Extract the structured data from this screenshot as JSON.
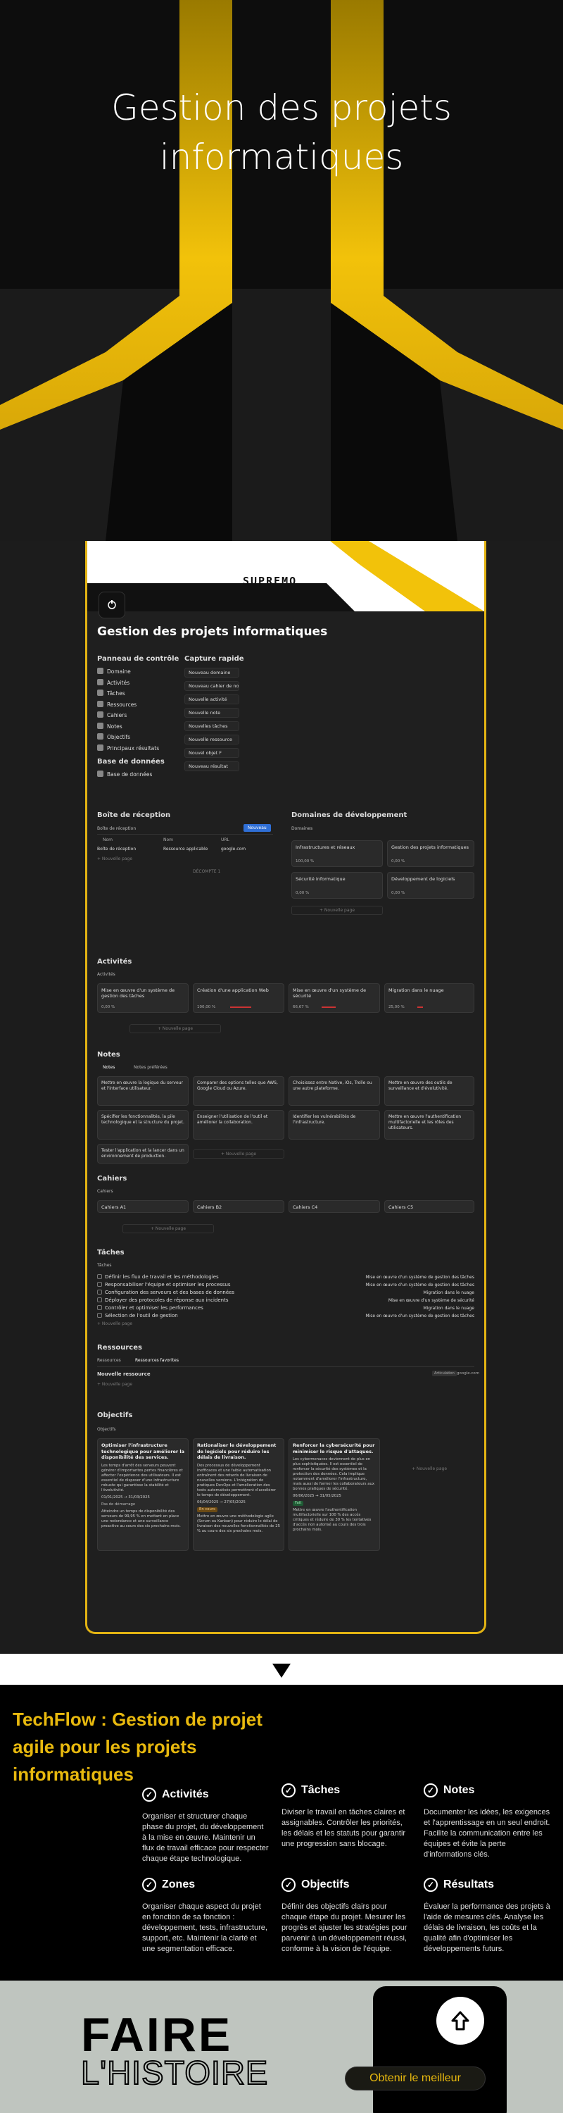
{
  "hero": {
    "title_line1": "Gestion des projets",
    "title_line2": "informatiques"
  },
  "app": {
    "logo": "SUPREMO",
    "page_title": "Gestion des projets informatiques",
    "panel": {
      "heading": "Panneau de contrôle",
      "items": [
        "Domaine",
        "Activités",
        "Tâches",
        "Ressources",
        "Cahiers",
        "Notes",
        "Objectifs",
        "Principaux résultats"
      ],
      "db_heading": "Base de données",
      "db_item": "Base de données"
    },
    "quick": {
      "heading": "Capture rapide",
      "items": [
        "Nouveau domaine",
        "Nouveau cahier de notes",
        "Nouvelle activité",
        "Nouvelle note",
        "Nouvelles tâches",
        "Nouvelle ressource",
        "Nouvel objet F",
        "Nouveau résultat"
      ]
    },
    "inbox": {
      "heading": "Boîte de réception",
      "tab": "Boîte de réception",
      "new_button": "Nouveau",
      "col1": "Nom",
      "col2": "Nom",
      "col3": "URL",
      "row_name": "Boîte de réception",
      "row_value": "Ressource applicable",
      "row_url": "google.com",
      "new_page": "+ Nouvelle page",
      "count": "DÉCOMPTE 1"
    },
    "domains": {
      "heading": "Domaines de développement",
      "tab": "Domaines",
      "cards": [
        {
          "title": "Infrastructures et réseaux",
          "pct": "100,00 %"
        },
        {
          "title": "Gestion des projets informatiques",
          "pct": "0,00 %"
        },
        {
          "title": "Sécurité informatique",
          "pct": "0,00 %"
        },
        {
          "title": "Développement de logiciels",
          "pct": "0,00 %"
        }
      ],
      "new_page": "+ Nouvelle page"
    },
    "activities": {
      "heading": "Activités",
      "tab": "Activités",
      "cards": [
        {
          "title": "Mise en œuvre d'un système de gestion des tâches",
          "pct": "0,00 %"
        },
        {
          "title": "Création d'une application Web",
          "pct": "100,00 %"
        },
        {
          "title": "Mise en œuvre d'un système de sécurité",
          "pct": "66,67 %"
        },
        {
          "title": "Migration dans le nuage",
          "pct": "25,00 %"
        }
      ],
      "new_page": "+ Nouvelle page"
    },
    "notes": {
      "heading": "Notes",
      "tab1": "Notes",
      "tab2": "Notes préférées",
      "cards": [
        "Mettre en œuvre la logique du serveur et l'interface utilisateur.",
        "Comparer des options telles que AWS, Google Cloud ou Azure.",
        "Choisissez entre Native, iOs, Trolle ou une autre plateforme.",
        "Mettre en œuvre des outils de surveillance et d'évolutivité.",
        "Spécifier les fonctionnalités, la pile technologique et la structure du projet.",
        "Enseigner l'utilisation de l'outil et améliorer la collaboration.",
        "Identifier les vulnérabilités de l'infrastructure.",
        "Mettre en œuvre l'authentification multifactorielle et les rôles des utilisateurs.",
        "Tester l'application et la lancer dans un environnement de production."
      ],
      "new_page": "+ Nouvelle page"
    },
    "notebooks": {
      "heading": "Cahiers",
      "tab": "Cahiers",
      "cards": [
        "Cahiers A1",
        "Cahiers B2",
        "Cahiers C4",
        "Cahiers C5"
      ],
      "new_page": "+ Nouvelle page"
    },
    "tasks": {
      "heading": "Tâches",
      "tab": "Tâches",
      "items": [
        "Définir les flux de travail et les méthodologies",
        "Responsabiliser l'équipe et optimiser les processus",
        "Configuration des serveurs et des bases de données",
        "Déployer des protocoles de réponse aux incidents",
        "Contrôler et optimiser les performances",
        "Sélection de l'outil de gestion"
      ],
      "relations": [
        "Mise en œuvre d'un système de gestion des tâches",
        "Mise en œuvre d'un système de gestion des tâches",
        "Migration dans le nuage",
        "Mise en œuvre d'un système de sécurité",
        "Migration dans le nuage",
        "Mise en œuvre d'un système de gestion des tâches"
      ],
      "new_page": "+ Nouvelle page"
    },
    "resources": {
      "heading": "Ressources",
      "tab1": "Ressources",
      "tab2": "Ressources favorites",
      "row": "Nouvelle ressource",
      "tag": "Articulation",
      "url": "google.com",
      "new_page": "+ Nouvelle page"
    },
    "objectives": {
      "heading": "Objectifs",
      "tab": "Objectifs",
      "cards": [
        {
          "title": "Optimiser l'infrastructure technologique pour améliorer la disponibilité des services.",
          "desc": "Les temps d'arrêt des serveurs peuvent générer d'importantes pertes financières et affecter l'expérience des utilisateurs. Il est essentiel de disposer d'une infrastructure robuste qui garantisse la stabilité et l'évolutivité.",
          "dates": "01/01/2025 → 31/03/2025",
          "tag": "Pas de démarrage",
          "note": "Atteindre un temps de disponibilité des serveurs de 99,95 % en mettant en place une redondance et une surveillance proactive au cours des six prochains mois."
        },
        {
          "title": "Rationaliser le développement de logiciels pour réduire les délais de livraison.",
          "desc": "Des processus de développement inefficaces et une faible automatisation entraînent des retards de livraison de nouvelles versions. L'intégration de pratiques DevOps et l'amélioration des tests automatisés permettront d'accélérer le temps de développement.",
          "dates": "06/04/2025 → 27/05/2025",
          "tag": "En cours",
          "note": "Mettre en œuvre une méthodologie agile (Scrum ou Kanban) pour réduire le délai de livraison des nouvelles fonctionnalités de 25 % au cours des six prochains mois."
        },
        {
          "title": "Renforcer la cybersécurité pour minimiser le risque d'attaques.",
          "desc": "Les cybermenaces deviennent de plus en plus sophistiquées. Il est essentiel de renforcer la sécurité des systèmes et la protection des données. Cela implique notamment d'améliorer l'infrastructure, mais aussi de former les collaborateurs aux bonnes pratiques de sécurité.",
          "dates": "06/06/2025 → 31/05/2025",
          "tag": "Fait",
          "note": "Mettre en œuvre l'authentification multifactorielle sur 100 % des accès critiques et réduire de 30 % les tentatives d'accès non autorisé au cours des trois prochains mois."
        }
      ],
      "new_page": "+ Nouvelle page"
    }
  },
  "features": {
    "title": "TechFlow : Gestion de projet agile pour les projets informatiques",
    "items": [
      {
        "title": "Activités",
        "desc": "Organiser et structurer chaque phase du projet, du développement à la mise en œuvre. Maintenir un flux de travail efficace pour respecter chaque étape technologique."
      },
      {
        "title": "Tâches",
        "desc": "Diviser le travail en tâches claires et assignables. Contrôler les priorités, les délais et les statuts pour garantir une progression sans blocage."
      },
      {
        "title": "Notes",
        "desc": "Documenter les idées, les exigences et l'apprentissage en un seul endroit. Facilite la communication entre les équipes et évite la perte d'informations clés."
      },
      {
        "title": "Zones",
        "desc": "Organiser chaque aspect du projet en fonction de sa fonction : développement, tests, infrastructure, support, etc. Maintenir la clarté et une segmentation efficace."
      },
      {
        "title": "Objectifs",
        "desc": "Définir des objectifs clairs pour chaque étape du projet. Mesurer les progrès et ajuster les stratégies pour parvenir à un développement réussi, conforme à la vision de l'équipe."
      },
      {
        "title": "Résultats",
        "desc": "Évaluer la performance des projets à l'aide de mesures clés. Analyse les délais de livraison, les coûts et la qualité afin d'optimiser les développements futurs."
      }
    ]
  },
  "footer": {
    "faire": "FAIRE",
    "histoire": "L'HISTOIRE",
    "cta": "Obtenir le meilleur"
  },
  "colors": {
    "accent": "#e8b90e",
    "bg": "#1c1c1c",
    "card": "#2a2a2a"
  }
}
